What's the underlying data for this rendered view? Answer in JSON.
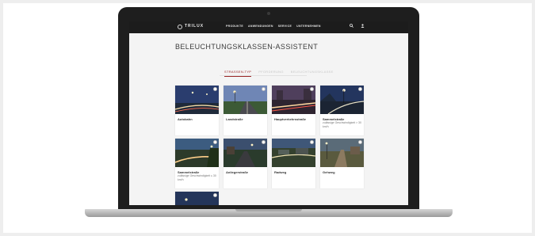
{
  "site": {
    "logo": "TRILUX",
    "nav": [
      "PRODUKTE",
      "ANWENDUNGEN",
      "SERVICE",
      "UNTERNEHMEN"
    ],
    "icons": [
      "search-icon",
      "user-icon"
    ]
  },
  "page": {
    "title": "BELEUCHTUNGSKLASSEN-ASSISTENT"
  },
  "wizard_tabs": [
    {
      "label": "STRASSEN-TYP",
      "active": true
    },
    {
      "label": "PFORDERUNG",
      "active": false
    },
    {
      "label": "BELEUCHTUNGSKLASSE",
      "active": false
    }
  ],
  "cards": [
    {
      "name": "Autobahn",
      "note": ""
    },
    {
      "name": "Landstraße",
      "note": ""
    },
    {
      "name": "Hauptverkehrsstraße",
      "note": ""
    },
    {
      "name": "Sammelstraße",
      "note": "zulässige Geschwindigkeit > 30 km/h"
    },
    {
      "name": "Sammelstraße",
      "note": "zulässige Geschwindigkeit ≤ 30 km/h"
    },
    {
      "name": "Anliegerstraße",
      "note": ""
    },
    {
      "name": "Radweg",
      "note": ""
    },
    {
      "name": "Gehweg",
      "note": ""
    },
    {
      "name": "",
      "note": ""
    }
  ],
  "colors": {
    "accent": "#9a2727",
    "header_bg": "#1c1c1c",
    "screen_bg": "#f4f4f4",
    "laptop_body": "#1e1e1e"
  }
}
